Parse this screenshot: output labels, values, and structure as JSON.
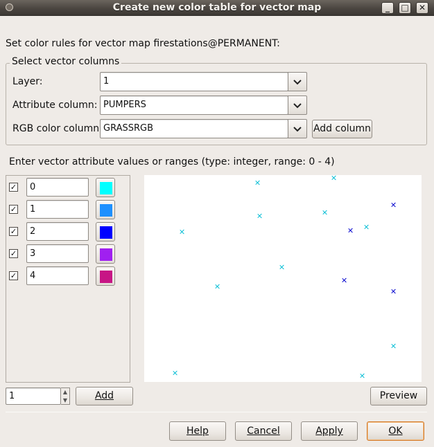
{
  "window": {
    "title": "Create new color table for vector map",
    "controls": {
      "minimize": "_",
      "maximize": "□",
      "close": "✕"
    }
  },
  "intro_text": "Set color rules for vector map firestations@PERMANENT:",
  "columns_frame": {
    "title": "Select vector columns",
    "layer_label": "Layer:",
    "layer_value": "1",
    "attribute_label": "Attribute column:",
    "attribute_value": "PUMPERS",
    "rgb_label": "RGB color column:",
    "rgb_value": "GRASSRGB",
    "add_column_label": "Add column"
  },
  "rules_caption": "Enter vector attribute values or ranges (type: integer, range: 0 - 4)",
  "rules": [
    {
      "checked": true,
      "value": "0",
      "color": "#00ffff"
    },
    {
      "checked": true,
      "value": "1",
      "color": "#1e90ff"
    },
    {
      "checked": true,
      "value": "2",
      "color": "#0000ff"
    },
    {
      "checked": true,
      "value": "3",
      "color": "#a020f0"
    },
    {
      "checked": true,
      "value": "4",
      "color": "#c71585"
    }
  ],
  "add_count_value": "1",
  "add_label": "Add",
  "preview_label": "Preview",
  "preview_marker_colors": [
    "#00bcd4",
    "#1e90ff",
    "#0000cd"
  ],
  "buttons": {
    "help": "Help",
    "cancel": "Cancel",
    "apply": "Apply",
    "ok": "OK"
  }
}
